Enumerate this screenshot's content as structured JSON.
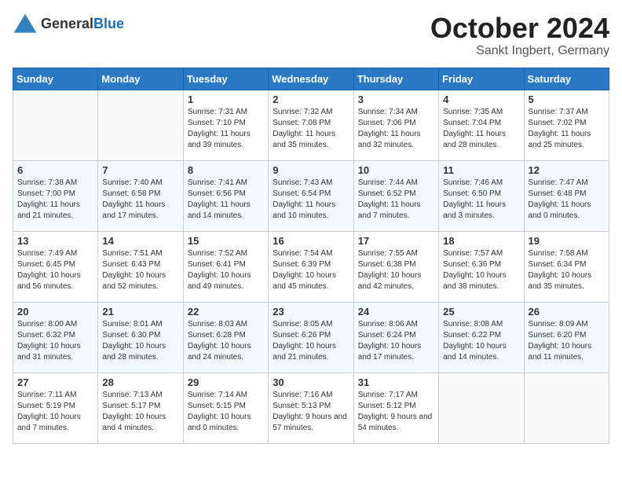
{
  "header": {
    "logo_general": "General",
    "logo_blue": "Blue",
    "month": "October 2024",
    "location": "Sankt Ingbert, Germany"
  },
  "weekdays": [
    "Sunday",
    "Monday",
    "Tuesday",
    "Wednesday",
    "Thursday",
    "Friday",
    "Saturday"
  ],
  "weeks": [
    [
      {
        "day": "",
        "sunrise": "",
        "sunset": "",
        "daylight": ""
      },
      {
        "day": "",
        "sunrise": "",
        "sunset": "",
        "daylight": ""
      },
      {
        "day": "1",
        "sunrise": "Sunrise: 7:31 AM",
        "sunset": "Sunset: 7:10 PM",
        "daylight": "Daylight: 11 hours and 39 minutes."
      },
      {
        "day": "2",
        "sunrise": "Sunrise: 7:32 AM",
        "sunset": "Sunset: 7:08 PM",
        "daylight": "Daylight: 11 hours and 35 minutes."
      },
      {
        "day": "3",
        "sunrise": "Sunrise: 7:34 AM",
        "sunset": "Sunset: 7:06 PM",
        "daylight": "Daylight: 11 hours and 32 minutes."
      },
      {
        "day": "4",
        "sunrise": "Sunrise: 7:35 AM",
        "sunset": "Sunset: 7:04 PM",
        "daylight": "Daylight: 11 hours and 28 minutes."
      },
      {
        "day": "5",
        "sunrise": "Sunrise: 7:37 AM",
        "sunset": "Sunset: 7:02 PM",
        "daylight": "Daylight: 11 hours and 25 minutes."
      }
    ],
    [
      {
        "day": "6",
        "sunrise": "Sunrise: 7:38 AM",
        "sunset": "Sunset: 7:00 PM",
        "daylight": "Daylight: 11 hours and 21 minutes."
      },
      {
        "day": "7",
        "sunrise": "Sunrise: 7:40 AM",
        "sunset": "Sunset: 6:58 PM",
        "daylight": "Daylight: 11 hours and 17 minutes."
      },
      {
        "day": "8",
        "sunrise": "Sunrise: 7:41 AM",
        "sunset": "Sunset: 6:56 PM",
        "daylight": "Daylight: 11 hours and 14 minutes."
      },
      {
        "day": "9",
        "sunrise": "Sunrise: 7:43 AM",
        "sunset": "Sunset: 6:54 PM",
        "daylight": "Daylight: 11 hours and 10 minutes."
      },
      {
        "day": "10",
        "sunrise": "Sunrise: 7:44 AM",
        "sunset": "Sunset: 6:52 PM",
        "daylight": "Daylight: 11 hours and 7 minutes."
      },
      {
        "day": "11",
        "sunrise": "Sunrise: 7:46 AM",
        "sunset": "Sunset: 6:50 PM",
        "daylight": "Daylight: 11 hours and 3 minutes."
      },
      {
        "day": "12",
        "sunrise": "Sunrise: 7:47 AM",
        "sunset": "Sunset: 6:48 PM",
        "daylight": "Daylight: 11 hours and 0 minutes."
      }
    ],
    [
      {
        "day": "13",
        "sunrise": "Sunrise: 7:49 AM",
        "sunset": "Sunset: 6:45 PM",
        "daylight": "Daylight: 10 hours and 56 minutes."
      },
      {
        "day": "14",
        "sunrise": "Sunrise: 7:51 AM",
        "sunset": "Sunset: 6:43 PM",
        "daylight": "Daylight: 10 hours and 52 minutes."
      },
      {
        "day": "15",
        "sunrise": "Sunrise: 7:52 AM",
        "sunset": "Sunset: 6:41 PM",
        "daylight": "Daylight: 10 hours and 49 minutes."
      },
      {
        "day": "16",
        "sunrise": "Sunrise: 7:54 AM",
        "sunset": "Sunset: 6:39 PM",
        "daylight": "Daylight: 10 hours and 45 minutes."
      },
      {
        "day": "17",
        "sunrise": "Sunrise: 7:55 AM",
        "sunset": "Sunset: 6:38 PM",
        "daylight": "Daylight: 10 hours and 42 minutes."
      },
      {
        "day": "18",
        "sunrise": "Sunrise: 7:57 AM",
        "sunset": "Sunset: 6:36 PM",
        "daylight": "Daylight: 10 hours and 38 minutes."
      },
      {
        "day": "19",
        "sunrise": "Sunrise: 7:58 AM",
        "sunset": "Sunset: 6:34 PM",
        "daylight": "Daylight: 10 hours and 35 minutes."
      }
    ],
    [
      {
        "day": "20",
        "sunrise": "Sunrise: 8:00 AM",
        "sunset": "Sunset: 6:32 PM",
        "daylight": "Daylight: 10 hours and 31 minutes."
      },
      {
        "day": "21",
        "sunrise": "Sunrise: 8:01 AM",
        "sunset": "Sunset: 6:30 PM",
        "daylight": "Daylight: 10 hours and 28 minutes."
      },
      {
        "day": "22",
        "sunrise": "Sunrise: 8:03 AM",
        "sunset": "Sunset: 6:28 PM",
        "daylight": "Daylight: 10 hours and 24 minutes."
      },
      {
        "day": "23",
        "sunrise": "Sunrise: 8:05 AM",
        "sunset": "Sunset: 6:26 PM",
        "daylight": "Daylight: 10 hours and 21 minutes."
      },
      {
        "day": "24",
        "sunrise": "Sunrise: 8:06 AM",
        "sunset": "Sunset: 6:24 PM",
        "daylight": "Daylight: 10 hours and 17 minutes."
      },
      {
        "day": "25",
        "sunrise": "Sunrise: 8:08 AM",
        "sunset": "Sunset: 6:22 PM",
        "daylight": "Daylight: 10 hours and 14 minutes."
      },
      {
        "day": "26",
        "sunrise": "Sunrise: 8:09 AM",
        "sunset": "Sunset: 6:20 PM",
        "daylight": "Daylight: 10 hours and 11 minutes."
      }
    ],
    [
      {
        "day": "27",
        "sunrise": "Sunrise: 7:11 AM",
        "sunset": "Sunset: 5:19 PM",
        "daylight": "Daylight: 10 hours and 7 minutes."
      },
      {
        "day": "28",
        "sunrise": "Sunrise: 7:13 AM",
        "sunset": "Sunset: 5:17 PM",
        "daylight": "Daylight: 10 hours and 4 minutes."
      },
      {
        "day": "29",
        "sunrise": "Sunrise: 7:14 AM",
        "sunset": "Sunset: 5:15 PM",
        "daylight": "Daylight: 10 hours and 0 minutes."
      },
      {
        "day": "30",
        "sunrise": "Sunrise: 7:16 AM",
        "sunset": "Sunset: 5:13 PM",
        "daylight": "Daylight: 9 hours and 57 minutes."
      },
      {
        "day": "31",
        "sunrise": "Sunrise: 7:17 AM",
        "sunset": "Sunset: 5:12 PM",
        "daylight": "Daylight: 9 hours and 54 minutes."
      },
      {
        "day": "",
        "sunrise": "",
        "sunset": "",
        "daylight": ""
      },
      {
        "day": "",
        "sunrise": "",
        "sunset": "",
        "daylight": ""
      }
    ]
  ]
}
